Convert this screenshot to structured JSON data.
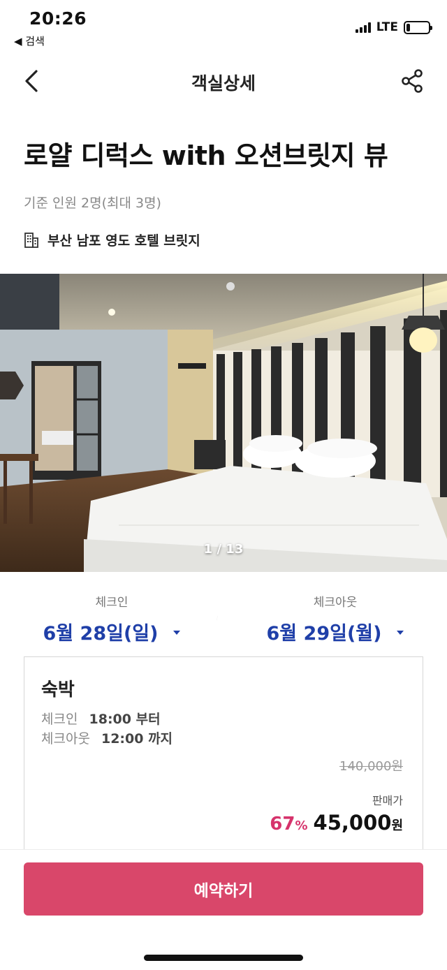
{
  "status_bar": {
    "time": "20:26",
    "back_to_app": "◀ 검색",
    "network": "LTE",
    "battery_level": 0.18
  },
  "header": {
    "title": "객실상세",
    "back_icon": "chevron-left-icon",
    "share_icon": "share-icon"
  },
  "room": {
    "title": "로얄 디럭스 with 오션브릿지 뷰",
    "capacity": "기준 인원 2명(최대 3명)",
    "hotel_icon": "building-icon",
    "hotel_name": "부산 남포 영도 호텔 브릿지"
  },
  "photo": {
    "counter": "1 / 13"
  },
  "dates": {
    "checkin_label": "체크인",
    "checkin_value": "6월 28일(일)",
    "checkout_label": "체크아웃",
    "checkout_value": "6월 29일(월)",
    "accent_color": "#1f3fa8"
  },
  "option": {
    "name": "숙박",
    "checkin_label": "체크인",
    "checkin_time": "18:00 부터",
    "checkout_label": "체크아웃",
    "checkout_time": "12:00 까지",
    "original_price": "140,000원",
    "sale_label": "판매가",
    "discount": "67",
    "discount_unit": "%",
    "sale_price": "45,000",
    "currency": "원",
    "discount_color": "#d6336c"
  },
  "cta": {
    "label": "예약하기",
    "color": "#d9476a"
  }
}
